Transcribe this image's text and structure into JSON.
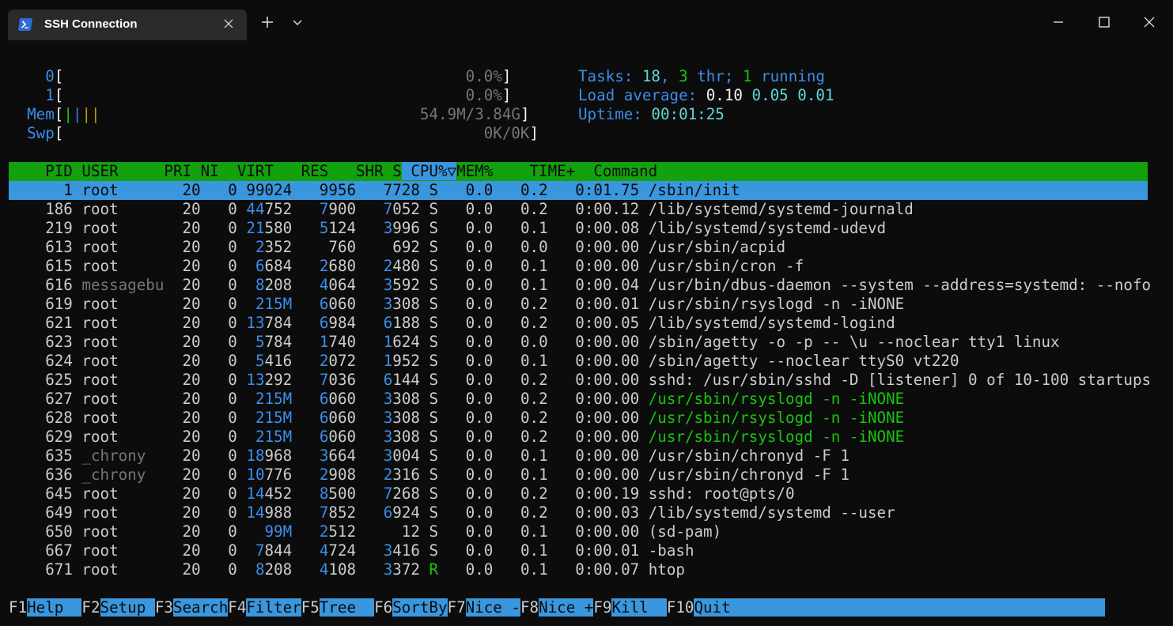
{
  "window": {
    "tab_title": "SSH Connection",
    "new_tab_icon": "plus-icon",
    "dropdown_icon": "chevron-down-icon",
    "controls": [
      "minimize-icon",
      "maximize-icon",
      "close-icon"
    ]
  },
  "meters": {
    "cpu0": {
      "label": "0",
      "value": "0.0%"
    },
    "cpu1": {
      "label": "1",
      "value": "0.0%"
    },
    "mem": {
      "label": "Mem",
      "value": "54.9M/3.84G"
    },
    "swp": {
      "label": "Swp",
      "value": "0K/0K"
    },
    "tasks": {
      "label": "Tasks: ",
      "count": "18",
      "sep1": ", ",
      "thr": "3",
      "thr_label": " thr; ",
      "running": "1",
      "running_label": " running"
    },
    "load": {
      "label": "Load average: ",
      "l1": "0.10",
      "l5": "0.05",
      "l15": "0.01"
    },
    "uptime": {
      "label": "Uptime: ",
      "value": "00:01:25"
    }
  },
  "table": {
    "columns": [
      "PID",
      "USER",
      "PRI",
      "NI",
      "VIRT",
      "RES",
      "SHR",
      "S",
      "CPU%▽",
      "MEM%",
      "TIME+",
      "Command"
    ],
    "rows": [
      {
        "pid": "1",
        "user": "root",
        "pri": "20",
        "ni": "0",
        "virt": "99024",
        "res": "9956",
        "shr": "7728",
        "s": "S",
        "cpu": "0.0",
        "mem": "0.2",
        "time": "0:01.75",
        "cmd": "/sbin/init"
      },
      {
        "pid": "186",
        "user": "root",
        "pri": "20",
        "ni": "0",
        "virt": "44752",
        "res": "7900",
        "shr": "7052",
        "s": "S",
        "cpu": "0.0",
        "mem": "0.2",
        "time": "0:00.12",
        "cmd": "/lib/systemd/systemd-journald"
      },
      {
        "pid": "219",
        "user": "root",
        "pri": "20",
        "ni": "0",
        "virt": "21580",
        "res": "5124",
        "shr": "3996",
        "s": "S",
        "cpu": "0.0",
        "mem": "0.1",
        "time": "0:00.08",
        "cmd": "/lib/systemd/systemd-udevd"
      },
      {
        "pid": "613",
        "user": "root",
        "pri": "20",
        "ni": "0",
        "virt": "2352",
        "res": "760",
        "shr": "692",
        "s": "S",
        "cpu": "0.0",
        "mem": "0.0",
        "time": "0:00.00",
        "cmd": "/usr/sbin/acpid"
      },
      {
        "pid": "615",
        "user": "root",
        "pri": "20",
        "ni": "0",
        "virt": "6684",
        "res": "2680",
        "shr": "2480",
        "s": "S",
        "cpu": "0.0",
        "mem": "0.1",
        "time": "0:00.00",
        "cmd": "/usr/sbin/cron -f"
      },
      {
        "pid": "616",
        "user": "messagebu",
        "pri": "20",
        "ni": "0",
        "virt": "8208",
        "res": "4064",
        "shr": "3592",
        "s": "S",
        "cpu": "0.0",
        "mem": "0.1",
        "time": "0:00.04",
        "cmd": "/usr/bin/dbus-daemon --system --address=systemd: --nofo"
      },
      {
        "pid": "619",
        "user": "root",
        "pri": "20",
        "ni": "0",
        "virt": "215M",
        "res": "6060",
        "shr": "3308",
        "s": "S",
        "cpu": "0.0",
        "mem": "0.2",
        "time": "0:00.01",
        "cmd": "/usr/sbin/rsyslogd -n -iNONE"
      },
      {
        "pid": "621",
        "user": "root",
        "pri": "20",
        "ni": "0",
        "virt": "13784",
        "res": "6984",
        "shr": "6188",
        "s": "S",
        "cpu": "0.0",
        "mem": "0.2",
        "time": "0:00.05",
        "cmd": "/lib/systemd/systemd-logind"
      },
      {
        "pid": "623",
        "user": "root",
        "pri": "20",
        "ni": "0",
        "virt": "5784",
        "res": "1740",
        "shr": "1624",
        "s": "S",
        "cpu": "0.0",
        "mem": "0.0",
        "time": "0:00.00",
        "cmd": "/sbin/agetty -o -p -- \\u --noclear tty1 linux"
      },
      {
        "pid": "624",
        "user": "root",
        "pri": "20",
        "ni": "0",
        "virt": "5416",
        "res": "2072",
        "shr": "1952",
        "s": "S",
        "cpu": "0.0",
        "mem": "0.1",
        "time": "0:00.00",
        "cmd": "/sbin/agetty --noclear ttyS0 vt220"
      },
      {
        "pid": "625",
        "user": "root",
        "pri": "20",
        "ni": "0",
        "virt": "13292",
        "res": "7036",
        "shr": "6144",
        "s": "S",
        "cpu": "0.0",
        "mem": "0.2",
        "time": "0:00.00",
        "cmd": "sshd: /usr/sbin/sshd -D [listener] 0 of 10-100 startups"
      },
      {
        "pid": "627",
        "user": "root",
        "pri": "20",
        "ni": "0",
        "virt": "215M",
        "res": "6060",
        "shr": "3308",
        "s": "S",
        "cpu": "0.0",
        "mem": "0.2",
        "time": "0:00.00",
        "cmd": "/usr/sbin/rsyslogd -n -iNONE"
      },
      {
        "pid": "628",
        "user": "root",
        "pri": "20",
        "ni": "0",
        "virt": "215M",
        "res": "6060",
        "shr": "3308",
        "s": "S",
        "cpu": "0.0",
        "mem": "0.2",
        "time": "0:00.00",
        "cmd": "/usr/sbin/rsyslogd -n -iNONE"
      },
      {
        "pid": "629",
        "user": "root",
        "pri": "20",
        "ni": "0",
        "virt": "215M",
        "res": "6060",
        "shr": "3308",
        "s": "S",
        "cpu": "0.0",
        "mem": "0.2",
        "time": "0:00.00",
        "cmd": "/usr/sbin/rsyslogd -n -iNONE"
      },
      {
        "pid": "635",
        "user": "_chrony",
        "pri": "20",
        "ni": "0",
        "virt": "18968",
        "res": "3664",
        "shr": "3004",
        "s": "S",
        "cpu": "0.0",
        "mem": "0.1",
        "time": "0:00.00",
        "cmd": "/usr/sbin/chronyd -F 1"
      },
      {
        "pid": "636",
        "user": "_chrony",
        "pri": "20",
        "ni": "0",
        "virt": "10776",
        "res": "2908",
        "shr": "2316",
        "s": "S",
        "cpu": "0.0",
        "mem": "0.1",
        "time": "0:00.00",
        "cmd": "/usr/sbin/chronyd -F 1"
      },
      {
        "pid": "645",
        "user": "root",
        "pri": "20",
        "ni": "0",
        "virt": "14452",
        "res": "8500",
        "shr": "7268",
        "s": "S",
        "cpu": "0.0",
        "mem": "0.2",
        "time": "0:00.19",
        "cmd": "sshd: root@pts/0"
      },
      {
        "pid": "649",
        "user": "root",
        "pri": "20",
        "ni": "0",
        "virt": "14988",
        "res": "7852",
        "shr": "6924",
        "s": "S",
        "cpu": "0.0",
        "mem": "0.2",
        "time": "0:00.03",
        "cmd": "/lib/systemd/systemd --user"
      },
      {
        "pid": "650",
        "user": "root",
        "pri": "20",
        "ni": "0",
        "virt": "99M",
        "res": "2512",
        "shr": "12",
        "s": "S",
        "cpu": "0.0",
        "mem": "0.1",
        "time": "0:00.00",
        "cmd": "(sd-pam)"
      },
      {
        "pid": "667",
        "user": "root",
        "pri": "20",
        "ni": "0",
        "virt": "7844",
        "res": "4724",
        "shr": "3416",
        "s": "S",
        "cpu": "0.0",
        "mem": "0.1",
        "time": "0:00.01",
        "cmd": "-bash"
      },
      {
        "pid": "671",
        "user": "root",
        "pri": "20",
        "ni": "0",
        "virt": "8208",
        "res": "4108",
        "shr": "3372",
        "s": "R",
        "cpu": "0.0",
        "mem": "0.1",
        "time": "0:00.07",
        "cmd": "htop"
      }
    ]
  },
  "fkeys": [
    {
      "key": "F1",
      "label": "Help  "
    },
    {
      "key": "F2",
      "label": "Setup "
    },
    {
      "key": "F3",
      "label": "Search"
    },
    {
      "key": "F4",
      "label": "Filter"
    },
    {
      "key": "F5",
      "label": "Tree  "
    },
    {
      "key": "F6",
      "label": "SortBy"
    },
    {
      "key": "F7",
      "label": "Nice -"
    },
    {
      "key": "F8",
      "label": "Nice +"
    },
    {
      "key": "F9",
      "label": "Kill  "
    },
    {
      "key": "F10",
      "label": "Quit"
    }
  ],
  "colors": {
    "header_bg": "#13a10e",
    "selection_bg": "#3a96dd",
    "terminal_bg": "#0c0c0c"
  }
}
